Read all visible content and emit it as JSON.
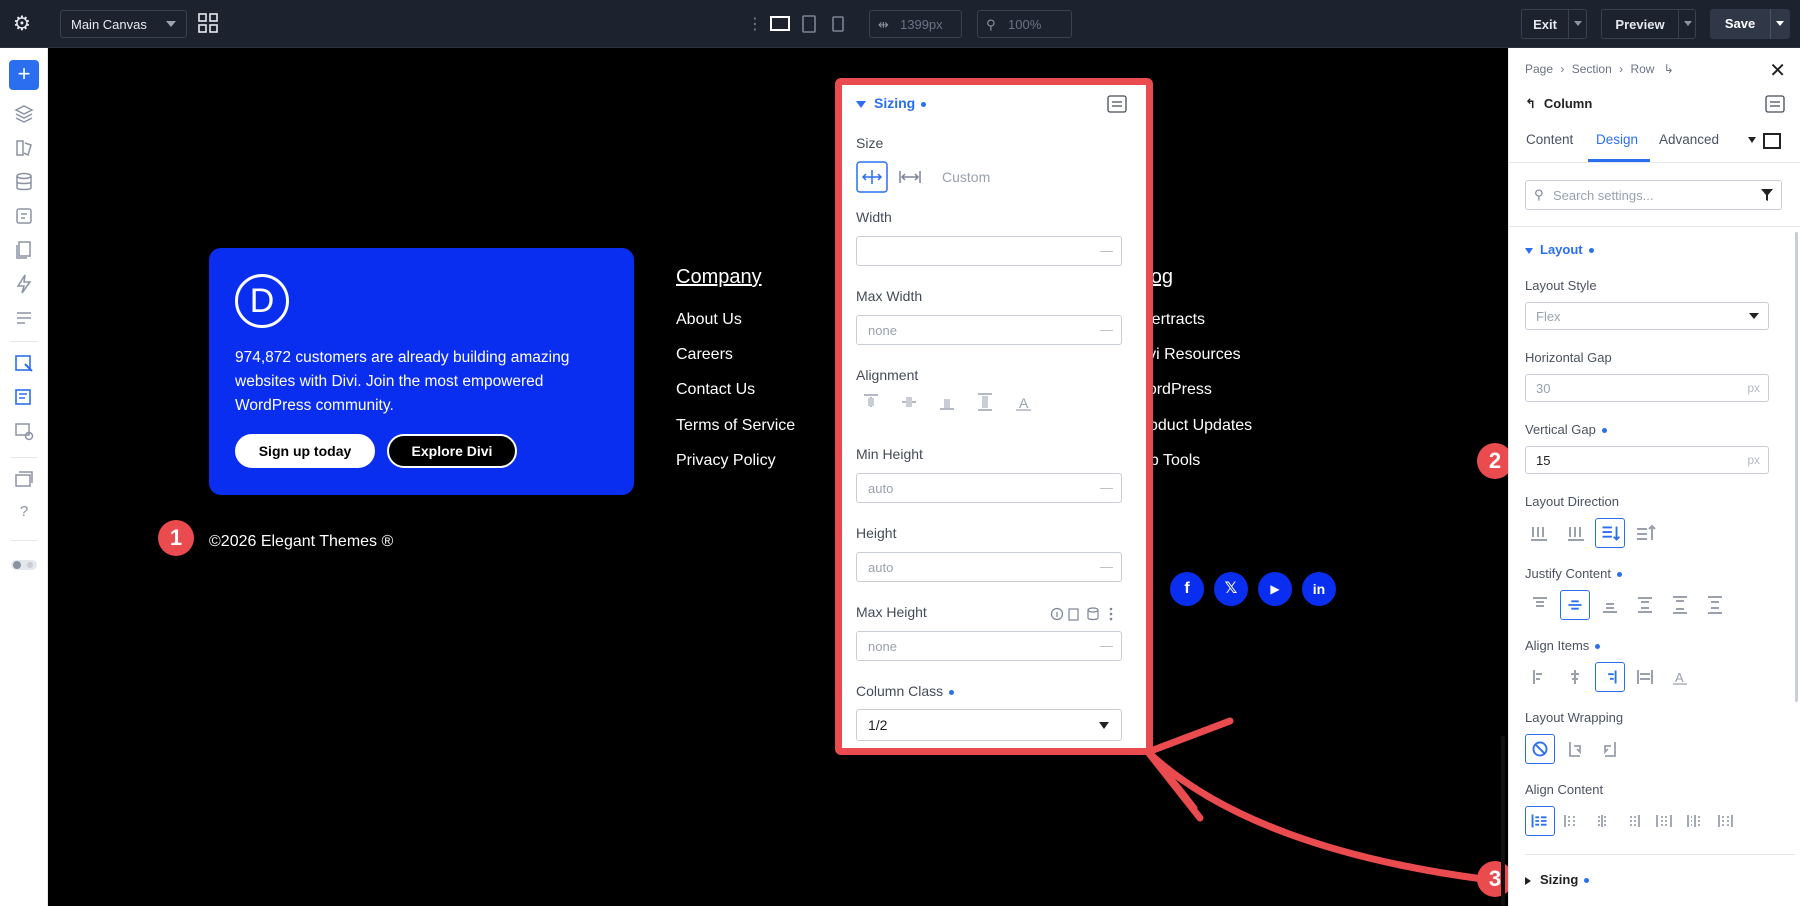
{
  "topbar": {
    "canvas_select": "Main Canvas",
    "width_value": "1399px",
    "zoom_value": "100%",
    "exit_label": "Exit",
    "preview_label": "Preview",
    "save_label": "Save"
  },
  "canvas": {
    "blue_card": {
      "logo_letter": "D",
      "text": "974,872 customers are already building amazing websites with Divi. Join the most empowered WordPress community.",
      "primary_button": "Sign up today",
      "secondary_button": "Explore Divi"
    },
    "company": {
      "title": "Company",
      "links": [
        "About Us",
        "Careers",
        "Contact Us",
        "Terms of Service",
        "Privacy Policy"
      ]
    },
    "blog": {
      "title": "Blog",
      "links": [
        "Ecertracts",
        "Divi Resources",
        "WordPress",
        "Product Updates",
        "Top Tools"
      ]
    },
    "copyright": "©2026 Elegant Themes ®",
    "socials": [
      "f",
      "𝕏",
      "▶",
      "in"
    ]
  },
  "badges": [
    "1",
    "2",
    "3"
  ],
  "sizing_panel": {
    "title": "Sizing",
    "size_label": "Size",
    "size_custom": "Custom",
    "width_label": "Width",
    "width_value": "",
    "max_width_label": "Max Width",
    "max_width_placeholder": "none",
    "alignment_label": "Alignment",
    "min_height_label": "Min Height",
    "min_height_placeholder": "auto",
    "height_label": "Height",
    "height_placeholder": "auto",
    "max_height_label": "Max Height",
    "max_height_placeholder": "none",
    "column_class_label": "Column Class",
    "column_class_value": "1/2"
  },
  "right_panel": {
    "breadcrumb": [
      "Page",
      "Section",
      "Row"
    ],
    "element_title": "Column",
    "tabs": [
      "Content",
      "Design",
      "Advanced"
    ],
    "active_tab": "Design",
    "search_placeholder": "Search settings...",
    "layout_section": "Layout",
    "layout_style_label": "Layout Style",
    "layout_style_value": "Flex",
    "horizontal_gap_label": "Horizontal Gap",
    "horizontal_gap_placeholder": "30",
    "vertical_gap_label": "Vertical Gap",
    "vertical_gap_value": "15",
    "unit": "px",
    "layout_direction_label": "Layout Direction",
    "justify_content_label": "Justify Content",
    "align_items_label": "Align Items",
    "layout_wrapping_label": "Layout Wrapping",
    "align_content_label": "Align Content",
    "sizing_section": "Sizing"
  },
  "colors": {
    "accent": "#2b6ff0",
    "highlight": "#ea4b4e",
    "brand_blue": "#0a2ef0",
    "topbar": "#1c222e"
  }
}
